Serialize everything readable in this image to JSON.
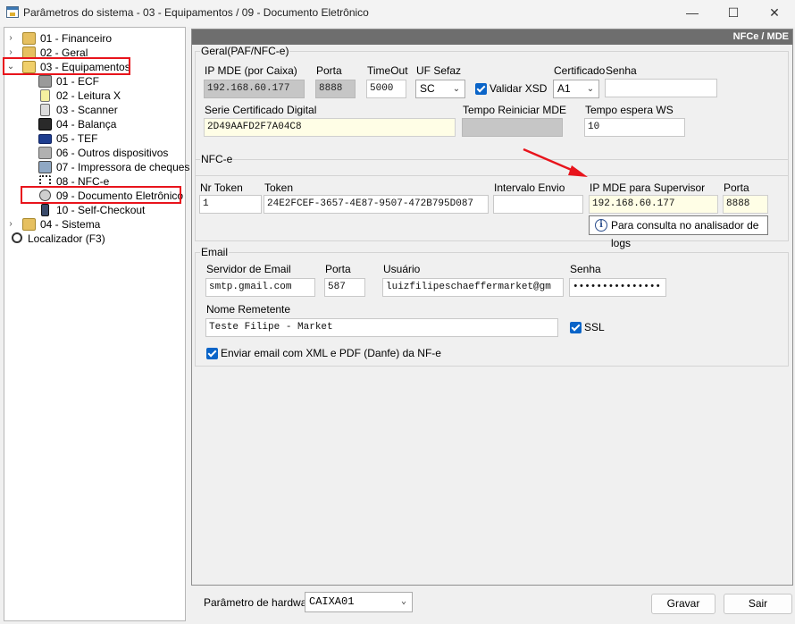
{
  "window": {
    "title": "Parâmetros do sistema - 03 - Equipamentos / 09 - Documento Eletrônico",
    "minimize": "—",
    "maximize": "☐",
    "close": "✕"
  },
  "tree": {
    "items": [
      {
        "label": "01 - Financeiro"
      },
      {
        "label": "02 - Geral"
      },
      {
        "label": "03 - Equipamentos"
      },
      {
        "label": "01 - ECF"
      },
      {
        "label": "02 - Leitura X"
      },
      {
        "label": "03 - Scanner"
      },
      {
        "label": "04 - Balança"
      },
      {
        "label": "05 - TEF"
      },
      {
        "label": "06 - Outros dispositivos"
      },
      {
        "label": "07 - Impressora de cheques"
      },
      {
        "label": "08 - NFC-e"
      },
      {
        "label": "09 - Documento Eletrônico"
      },
      {
        "label": "10 - Self-Checkout"
      },
      {
        "label": "04 - Sistema"
      },
      {
        "label": "Localizador (F3)"
      }
    ]
  },
  "main": {
    "header": "NFCe / MDE",
    "geral": {
      "legend": "Geral(PAF/NFC-e)",
      "ip_mde_label": "IP MDE (por Caixa)",
      "ip_mde_value": "192.168.60.177",
      "porta_label": "Porta",
      "porta_value": "8888",
      "timeout_label": "TimeOut",
      "timeout_value": "5000",
      "uf_label": "UF Sefaz",
      "uf_value": "SC",
      "validar_xsd_label": "Validar XSD",
      "certificado_label": "Certificado",
      "certificado_value": "A1",
      "senha_label": "Senha",
      "senha_value": "",
      "serie_label": "Serie Certificado Digital",
      "serie_value": "2D49AAFD2F7A04C8",
      "tempo_reiniciar_label": "Tempo Reiniciar MDE",
      "tempo_reiniciar_value": "",
      "tempo_espera_label": "Tempo espera WS",
      "tempo_espera_value": "10"
    },
    "nfce": {
      "legend": "NFC-e",
      "nr_token_label": "Nr Token",
      "nr_token_value": "1",
      "token_label": "Token",
      "token_value": "24E2FCEF-3657-4E87-9507-472B795D087",
      "intervalo_label": "Intervalo Envio",
      "intervalo_value": "",
      "ip_supervisor_label": "IP MDE para Supervisor",
      "ip_supervisor_value": "192.168.60.177",
      "porta_label": "Porta",
      "porta_value": "8888",
      "consulta_button": "Para consulta no analisador de logs"
    },
    "email": {
      "legend": "Email",
      "servidor_label": "Servidor de Email",
      "servidor_value": "smtp.gmail.com",
      "porta_label": "Porta",
      "porta_value": "587",
      "usuario_label": "Usuário",
      "usuario_value": "luizfilipeschaeffermarket@gm",
      "senha_label": "Senha",
      "senha_value": "•••••••••••••••",
      "remetente_label": "Nome Remetente",
      "remetente_value": "Teste Filipe - Market",
      "ssl_label": "SSL",
      "enviar_label": "Enviar email com XML e PDF (Danfe) da NF-e"
    }
  },
  "footer": {
    "hardware_label": "Parâmetro de hardware",
    "hardware_value": "CAIXA01",
    "gravar_button": "Gravar",
    "sair_button": "Sair"
  },
  "colors": {
    "highlight": "#e8141c",
    "arrow": "#e8141c",
    "header_bg": "#6e6e6e",
    "checkbox": "#0a64c8",
    "readonly_field": "#c6c6c6",
    "required_field": "#fffee6"
  },
  "icons": {
    "app": "folder-settings-icon",
    "tree_financeiro": "magnifier-folder-icon",
    "tree_geral": "magnifier-folder-icon",
    "tree_equipamentos": "open-folder-icon",
    "ecf": "printer-icon",
    "leitura_x": "receipt-icon",
    "scanner": "barcode-scanner-icon",
    "balanca": "scale-icon",
    "tef": "visa-card-icon",
    "outros": "tools-icon",
    "impressora_cheques": "cheque-printer-icon",
    "nfce": "qr-code-icon",
    "documento": "globe-icon",
    "self_checkout": "kiosk-icon",
    "sistema": "magnifier-folder-icon",
    "localizador": "magnifier-icon",
    "info": "info-icon"
  }
}
